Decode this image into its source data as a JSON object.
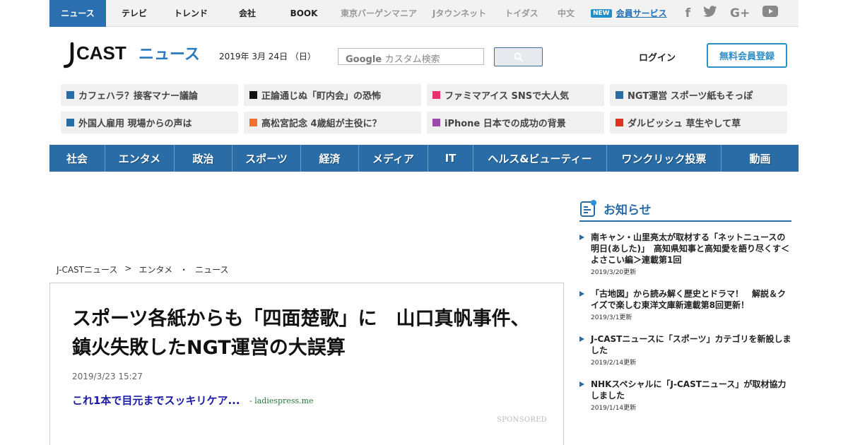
{
  "topbar": {
    "tabs": [
      {
        "label": "ニュース",
        "active": true
      },
      {
        "label": "テレビ"
      },
      {
        "label": "トレンド"
      },
      {
        "label": "会社"
      },
      {
        "label": "BOOK"
      },
      {
        "label": "東京バーゲンマニア",
        "dim": true
      },
      {
        "label": "Jタウンネット",
        "dim": true
      },
      {
        "label": "トイダス",
        "dim": true
      },
      {
        "label": "中文",
        "dim": true
      }
    ],
    "new_badge": "NEW",
    "member_service": "会員サービス",
    "social": [
      "facebook-icon",
      "twitter-icon",
      "google-plus-icon",
      "youtube-icon"
    ]
  },
  "header": {
    "date": "2019年 3月 24日 （日）",
    "search_placeholder": "カスタム検索",
    "login": "ログイン",
    "register": "無料会員登録"
  },
  "headlines": [
    {
      "label": "カフェハラ？接客マナー議論",
      "color": "#2a6ca5"
    },
    {
      "label": "正論通じぬ「町内会」の恐怖",
      "color": "#111111"
    },
    {
      "label": "ファミマアイス SNSで大人気",
      "color": "#e8306c"
    },
    {
      "label": "NGT運営 スポーツ紙もそっぽ",
      "color": "#2a6ca5"
    },
    {
      "label": "外国人雇用 現場からの声は",
      "color": "#2a6ca5"
    },
    {
      "label": "高松宮記念 4歳組が主役に？",
      "color": "#f07030"
    },
    {
      "label": "iPhone 日本での成功の背景",
      "color": "#9a4aa8"
    },
    {
      "label": "ダルビッシュ 草生やして草",
      "color": "#e03020"
    }
  ],
  "categories": [
    "社会",
    "エンタメ",
    "政治",
    "スポーツ",
    "経済",
    "メディア",
    "IT",
    "ヘルス&ビューティー",
    "ワンクリック投票",
    "動画"
  ],
  "breadcrumb": [
    "J-CASTニュース",
    ">",
    "エンタメ",
    "・",
    "ニュース"
  ],
  "article": {
    "title": "スポーツ各紙からも「四面楚歌」に　山口真帆事件、鎮火失敗したNGT運営の大誤算",
    "date": "2019/3/23 15:27",
    "ad_text": "これ1本で目元までスッキリケア...",
    "ad_source": "- ladiespress.me",
    "sponsored": "SPONSORED"
  },
  "sidebar": {
    "heading": "お知らせ",
    "items": [
      {
        "text": "南キャン・山里亮太が取材する「ネットニュースの明日(あした)」　高知県知事と高知愛を語り尽くす＜よさこい編＞連載第1回",
        "date": "2019/3/20更新"
      },
      {
        "text": "「古地図」から読み解く歴史とドラマ！　解説＆クイズで楽しむ東洋文庫新連載第8回更新！",
        "date": "2019/3/1更新"
      },
      {
        "text": "J-CASTニュースに「スポーツ」カテゴリを新設しました",
        "date": "2019/2/14更新"
      },
      {
        "text": "NHKスペシャルに「J-CASTニュース」が取材協力しました",
        "date": "2019/1/14更新"
      }
    ]
  },
  "colors": {
    "brand": "#2a6ca5",
    "accent": "#2b8fc9"
  }
}
